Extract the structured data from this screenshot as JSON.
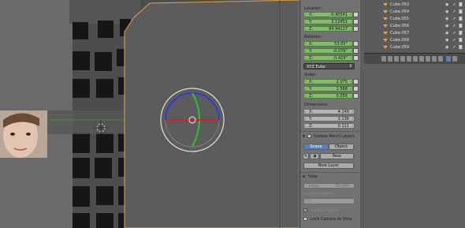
{
  "transform": {
    "location_label": "Location:",
    "location": [
      {
        "axis": "X:",
        "value": "-0.40541"
      },
      {
        "axis": "Y:",
        "value": "2.12451"
      },
      {
        "axis": "Z:",
        "value": "84.94117"
      }
    ],
    "rotation_label": "Rotation:",
    "rotation": [
      {
        "axis": "X:",
        "value": "53.05°"
      },
      {
        "axis": "Y:",
        "value": "-0.076°"
      },
      {
        "axis": "Z:",
        "value": "-0.429°"
      }
    ],
    "rotation_mode": "XYZ Euler",
    "scale_label": "Scale:",
    "scale": [
      {
        "axis": "X:",
        "value": "2.075"
      },
      {
        "axis": "Y:",
        "value": "1.568"
      },
      {
        "axis": "Z:",
        "value": "0.056"
      }
    ],
    "dimensions_label": "Dimensions:",
    "dimensions": [
      {
        "axis": "X:",
        "value": "4.149"
      },
      {
        "axis": "Y:",
        "value": "3.136"
      },
      {
        "axis": "Z:",
        "value": "0.111"
      }
    ]
  },
  "grease_pencil": {
    "title": "Grease Pencil Layers",
    "tab_scene": "Scene",
    "tab_object": "Object",
    "new_label": "New",
    "new_layer_label": "New Layer"
  },
  "view": {
    "title": "View",
    "lens_label": "Lens:",
    "lens_value": "35.000",
    "lock_to_object_label": "Lock to Object:",
    "lock_to_cursor_label": "Lock to Cursor",
    "lock_camera_label": "Lock Camera to View"
  },
  "outliner": {
    "items": [
      {
        "label": "Cube.053"
      },
      {
        "label": "Cube.054"
      },
      {
        "label": "Cube.055"
      },
      {
        "label": "Cube.056"
      },
      {
        "label": "Cube.057"
      },
      {
        "label": "Cube.058"
      },
      {
        "label": "Cube.059"
      }
    ]
  },
  "colors": {
    "selected_outline": "#e8a24a",
    "field_green": "#7fbf66",
    "tab_active": "#5680c2",
    "gizmo_x": "#d42020",
    "gizmo_y": "#2ec12e",
    "gizmo_z": "#2a3fd8"
  }
}
